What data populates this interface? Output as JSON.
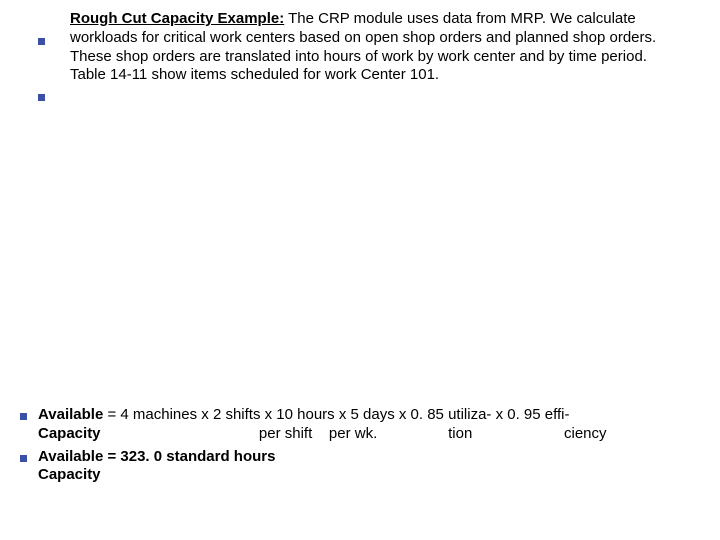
{
  "slide": {
    "top": {
      "lead": "Rough Cut Capacity Example:",
      "body": " The CRP module uses data from MRP. We calculate workloads for critical work centers based on open shop orders and planned shop orders. These shop orders are translated into hours of work by work center and by time period. Table 14-11 show items scheduled for work Center 101."
    },
    "bottom": {
      "line1_a": "Available",
      "line1_b": " = 4 machines x 2 shifts x 10 hours x 5 days x 0. 85 utiliza- x 0. 95 effi-",
      "line2_a": "Capacity                                      ",
      "line2_b": "per shift    per wk.                 tion                      ciency",
      "line3_a": "Available = 323. 0 standard hours",
      "line4_a": "Capacity"
    }
  }
}
